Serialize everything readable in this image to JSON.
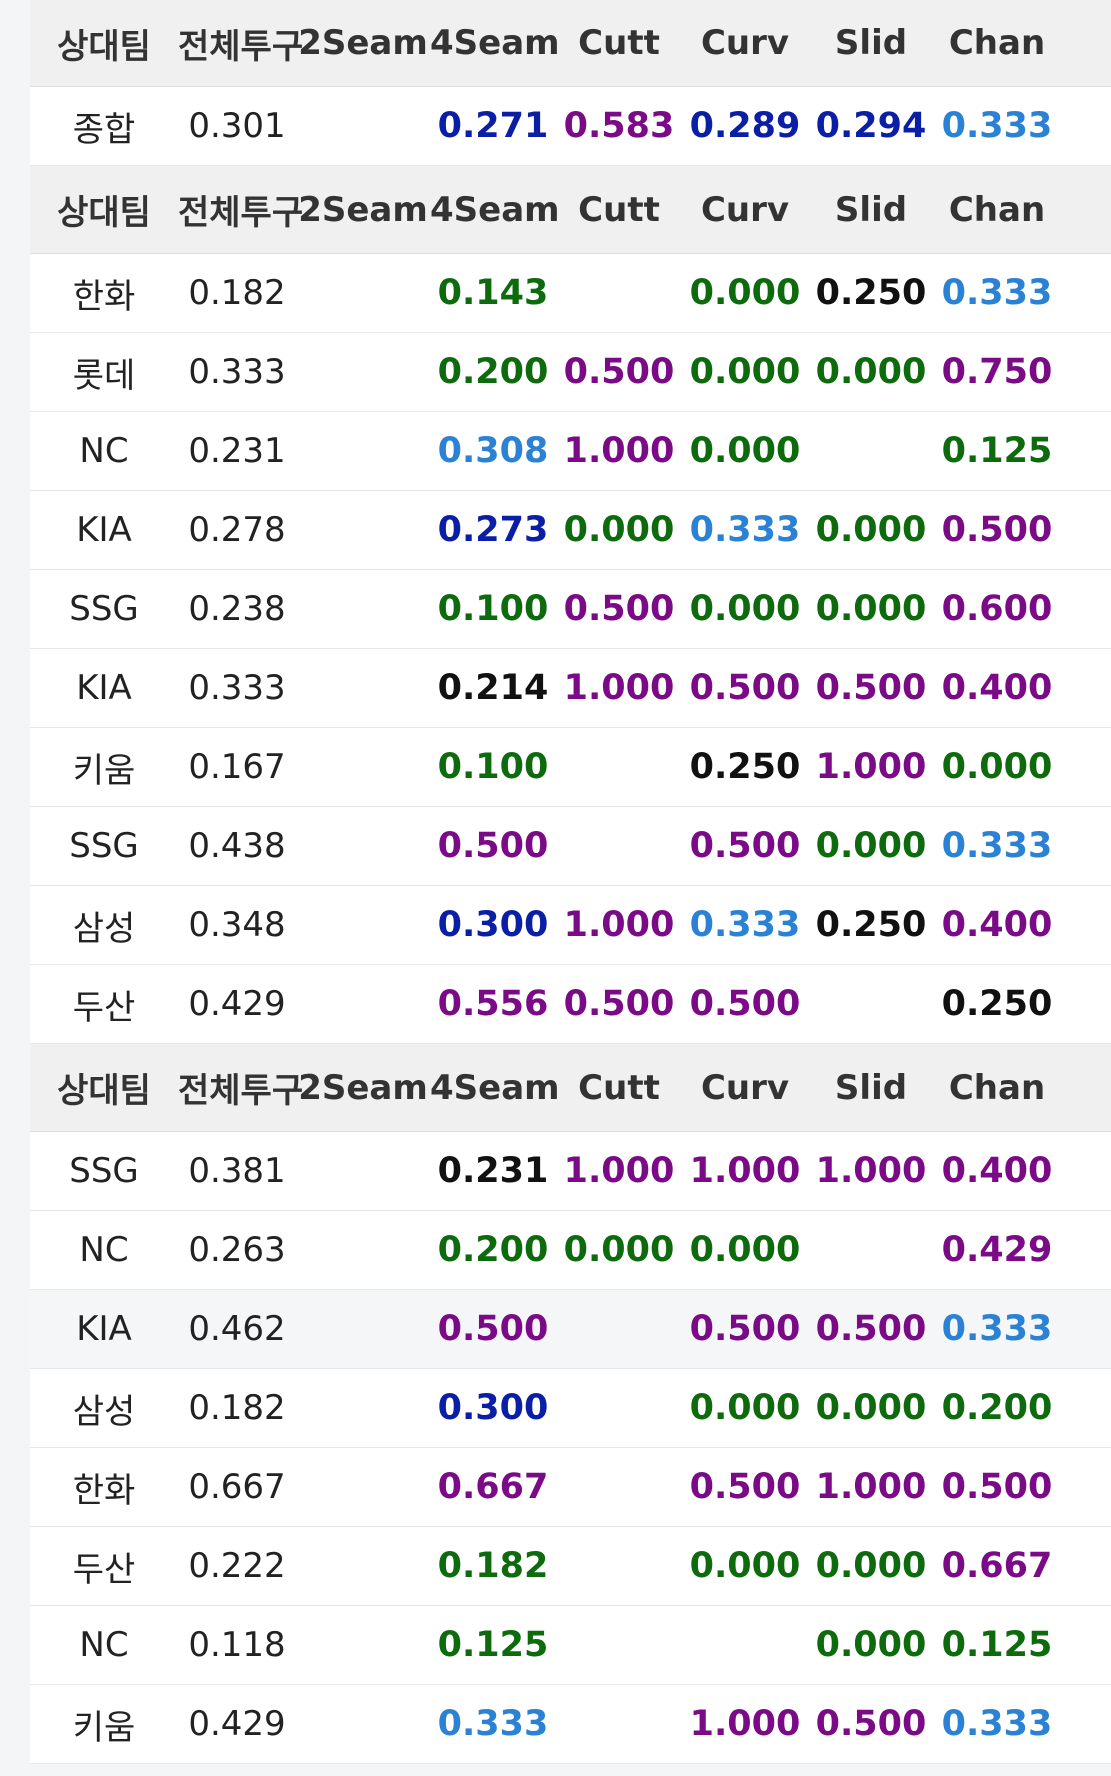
{
  "headers": [
    "상대팀",
    "전체투구",
    "2Seam",
    "4Seam",
    "Cutt",
    "Curv",
    "Slid",
    "Chan"
  ],
  "colors": {
    "green": "#0d6b0d",
    "purple": "#7a0a86",
    "navy": "#0b1ea6",
    "sky": "#2b82d4",
    "black": "#111111"
  },
  "sections": [
    {
      "rows": [
        {
          "team": "종합",
          "total": "0.301",
          "vals": [
            [
              "",
              ""
            ],
            [
              "0.271",
              "navy"
            ],
            [
              "0.583",
              "purple"
            ],
            [
              "0.289",
              "navy"
            ],
            [
              "0.294",
              "navy"
            ],
            [
              "0.333",
              "sky"
            ]
          ]
        }
      ]
    },
    {
      "rows": [
        {
          "team": "한화",
          "total": "0.182",
          "vals": [
            [
              "",
              ""
            ],
            [
              "0.143",
              "green"
            ],
            [
              "",
              ""
            ],
            [
              "0.000",
              "green"
            ],
            [
              "0.250",
              "black"
            ],
            [
              "0.333",
              "sky"
            ]
          ]
        },
        {
          "team": "롯데",
          "total": "0.333",
          "vals": [
            [
              "",
              ""
            ],
            [
              "0.200",
              "green"
            ],
            [
              "0.500",
              "purple"
            ],
            [
              "0.000",
              "green"
            ],
            [
              "0.000",
              "green"
            ],
            [
              "0.750",
              "purple"
            ]
          ]
        },
        {
          "team": "NC",
          "total": "0.231",
          "vals": [
            [
              "",
              ""
            ],
            [
              "0.308",
              "sky"
            ],
            [
              "1.000",
              "purple"
            ],
            [
              "0.000",
              "green"
            ],
            [
              "",
              ""
            ],
            [
              "0.125",
              "green"
            ]
          ]
        },
        {
          "team": "KIA",
          "total": "0.278",
          "vals": [
            [
              "",
              ""
            ],
            [
              "0.273",
              "navy"
            ],
            [
              "0.000",
              "green"
            ],
            [
              "0.333",
              "sky"
            ],
            [
              "0.000",
              "green"
            ],
            [
              "0.500",
              "purple"
            ]
          ]
        },
        {
          "team": "SSG",
          "total": "0.238",
          "vals": [
            [
              "",
              ""
            ],
            [
              "0.100",
              "green"
            ],
            [
              "0.500",
              "purple"
            ],
            [
              "0.000",
              "green"
            ],
            [
              "0.000",
              "green"
            ],
            [
              "0.600",
              "purple"
            ]
          ]
        },
        {
          "team": "KIA",
          "total": "0.333",
          "vals": [
            [
              "",
              ""
            ],
            [
              "0.214",
              "black"
            ],
            [
              "1.000",
              "purple"
            ],
            [
              "0.500",
              "purple"
            ],
            [
              "0.500",
              "purple"
            ],
            [
              "0.400",
              "purple"
            ]
          ]
        },
        {
          "team": "키움",
          "total": "0.167",
          "vals": [
            [
              "",
              ""
            ],
            [
              "0.100",
              "green"
            ],
            [
              "",
              ""
            ],
            [
              "0.250",
              "black"
            ],
            [
              "1.000",
              "purple"
            ],
            [
              "0.000",
              "green"
            ]
          ]
        },
        {
          "team": "SSG",
          "total": "0.438",
          "vals": [
            [
              "",
              ""
            ],
            [
              "0.500",
              "purple"
            ],
            [
              "",
              ""
            ],
            [
              "0.500",
              "purple"
            ],
            [
              "0.000",
              "green"
            ],
            [
              "0.333",
              "sky"
            ]
          ]
        },
        {
          "team": "삼성",
          "total": "0.348",
          "vals": [
            [
              "",
              ""
            ],
            [
              "0.300",
              "navy"
            ],
            [
              "1.000",
              "purple"
            ],
            [
              "0.333",
              "sky"
            ],
            [
              "0.250",
              "black"
            ],
            [
              "0.400",
              "purple"
            ]
          ]
        },
        {
          "team": "두산",
          "total": "0.429",
          "vals": [
            [
              "",
              ""
            ],
            [
              "0.556",
              "purple"
            ],
            [
              "0.500",
              "purple"
            ],
            [
              "0.500",
              "purple"
            ],
            [
              "",
              ""
            ],
            [
              "0.250",
              "black"
            ]
          ]
        }
      ]
    },
    {
      "rows": [
        {
          "team": "SSG",
          "total": "0.381",
          "vals": [
            [
              "",
              ""
            ],
            [
              "0.231",
              "black"
            ],
            [
              "1.000",
              "purple"
            ],
            [
              "1.000",
              "purple"
            ],
            [
              "1.000",
              "purple"
            ],
            [
              "0.400",
              "purple"
            ]
          ]
        },
        {
          "team": "NC",
          "total": "0.263",
          "vals": [
            [
              "",
              ""
            ],
            [
              "0.200",
              "green"
            ],
            [
              "0.000",
              "green"
            ],
            [
              "0.000",
              "green"
            ],
            [
              "",
              ""
            ],
            [
              "0.429",
              "purple"
            ]
          ]
        },
        {
          "team": "KIA",
          "total": "0.462",
          "alt": true,
          "vals": [
            [
              "",
              ""
            ],
            [
              "0.500",
              "purple"
            ],
            [
              "",
              ""
            ],
            [
              "0.500",
              "purple"
            ],
            [
              "0.500",
              "purple"
            ],
            [
              "0.333",
              "sky"
            ]
          ]
        },
        {
          "team": "삼성",
          "total": "0.182",
          "vals": [
            [
              "",
              ""
            ],
            [
              "0.300",
              "navy"
            ],
            [
              "",
              ""
            ],
            [
              "0.000",
              "green"
            ],
            [
              "0.000",
              "green"
            ],
            [
              "0.200",
              "green"
            ]
          ]
        },
        {
          "team": "한화",
          "total": "0.667",
          "vals": [
            [
              "",
              ""
            ],
            [
              "0.667",
              "purple"
            ],
            [
              "",
              ""
            ],
            [
              "0.500",
              "purple"
            ],
            [
              "1.000",
              "purple"
            ],
            [
              "0.500",
              "purple"
            ]
          ]
        },
        {
          "team": "두산",
          "total": "0.222",
          "vals": [
            [
              "",
              ""
            ],
            [
              "0.182",
              "green"
            ],
            [
              "",
              ""
            ],
            [
              "0.000",
              "green"
            ],
            [
              "0.000",
              "green"
            ],
            [
              "0.667",
              "purple"
            ]
          ]
        },
        {
          "team": "NC",
          "total": "0.118",
          "vals": [
            [
              "",
              ""
            ],
            [
              "0.125",
              "green"
            ],
            [
              "",
              ""
            ],
            [
              "",
              ""
            ],
            [
              "0.000",
              "green"
            ],
            [
              "0.125",
              "green"
            ]
          ]
        },
        {
          "team": "키움",
          "total": "0.429",
          "vals": [
            [
              "",
              ""
            ],
            [
              "0.333",
              "sky"
            ],
            [
              "",
              ""
            ],
            [
              "1.000",
              "purple"
            ],
            [
              "0.500",
              "purple"
            ],
            [
              "0.333",
              "sky"
            ]
          ]
        }
      ]
    }
  ]
}
